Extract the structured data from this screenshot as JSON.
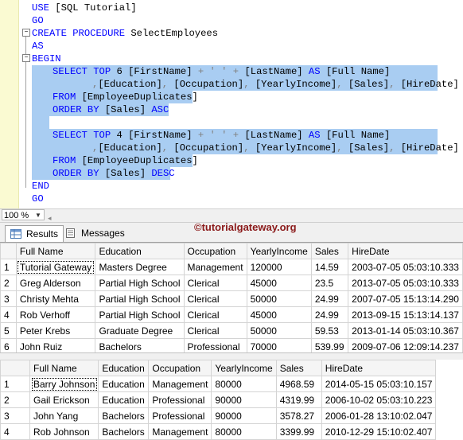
{
  "editor": {
    "lines": [
      {
        "parts": [
          {
            "t": "USE",
            "c": "kw"
          },
          {
            "t": " [SQL Tutorial]",
            "c": "id"
          }
        ]
      },
      {
        "parts": [
          {
            "t": "GO",
            "c": "kw"
          }
        ]
      },
      {
        "parts": [
          {
            "t": "CREATE PROCEDURE",
            "c": "kw"
          },
          {
            "t": " SelectEmployees",
            "c": "id"
          }
        ]
      },
      {
        "parts": [
          {
            "t": "AS",
            "c": "kw"
          }
        ]
      },
      {
        "parts": [
          {
            "t": "BEGIN",
            "c": "kw"
          }
        ]
      },
      {
        "parts": [
          {
            "t": "SELECT TOP",
            "c": "kw"
          },
          {
            "t": " 6 [FirstName] ",
            "c": "id"
          },
          {
            "t": "+",
            "c": "op"
          },
          {
            "t": " ",
            "c": "id"
          },
          {
            "t": "' '",
            "c": "op"
          },
          {
            "t": " ",
            "c": "id"
          },
          {
            "t": "+",
            "c": "op"
          },
          {
            "t": " [LastName] ",
            "c": "id"
          },
          {
            "t": "AS",
            "c": "kw"
          },
          {
            "t": " [Full Name]",
            "c": "id"
          }
        ]
      },
      {
        "parts": [
          {
            "t": ",",
            "c": "op"
          },
          {
            "t": "[Education]",
            "c": "id"
          },
          {
            "t": ",",
            "c": "op"
          },
          {
            "t": " [Occupation]",
            "c": "id"
          },
          {
            "t": ",",
            "c": "op"
          },
          {
            "t": " [YearlyIncome]",
            "c": "id"
          },
          {
            "t": ",",
            "c": "op"
          },
          {
            "t": " [Sales]",
            "c": "id"
          },
          {
            "t": ",",
            "c": "op"
          },
          {
            "t": " [HireDate]",
            "c": "id"
          }
        ]
      },
      {
        "parts": [
          {
            "t": "FROM",
            "c": "kw"
          },
          {
            "t": " [EmployeeDuplicates]",
            "c": "id"
          }
        ]
      },
      {
        "parts": [
          {
            "t": "ORDER BY",
            "c": "kw"
          },
          {
            "t": " [Sales] ",
            "c": "id"
          },
          {
            "t": "ASC",
            "c": "kw"
          }
        ]
      },
      {
        "parts": []
      },
      {
        "parts": [
          {
            "t": "SELECT TOP",
            "c": "kw"
          },
          {
            "t": " 4 [FirstName] ",
            "c": "id"
          },
          {
            "t": "+",
            "c": "op"
          },
          {
            "t": " ",
            "c": "id"
          },
          {
            "t": "' '",
            "c": "op"
          },
          {
            "t": " ",
            "c": "id"
          },
          {
            "t": "+",
            "c": "op"
          },
          {
            "t": " [LastName] ",
            "c": "id"
          },
          {
            "t": "AS",
            "c": "kw"
          },
          {
            "t": " [Full Name]",
            "c": "id"
          }
        ]
      },
      {
        "parts": [
          {
            "t": ",",
            "c": "op"
          },
          {
            "t": "[Education]",
            "c": "id"
          },
          {
            "t": ",",
            "c": "op"
          },
          {
            "t": " [Occupation]",
            "c": "id"
          },
          {
            "t": ",",
            "c": "op"
          },
          {
            "t": " [YearlyIncome]",
            "c": "id"
          },
          {
            "t": ",",
            "c": "op"
          },
          {
            "t": " [Sales]",
            "c": "id"
          },
          {
            "t": ",",
            "c": "op"
          },
          {
            "t": " [HireDate]",
            "c": "id"
          }
        ]
      },
      {
        "parts": [
          {
            "t": "FROM",
            "c": "kw"
          },
          {
            "t": " [EmployeeDuplicates]",
            "c": "id"
          }
        ]
      },
      {
        "parts": [
          {
            "t": "ORDER BY",
            "c": "kw"
          },
          {
            "t": " [Sales] ",
            "c": "id"
          },
          {
            "t": "DESC",
            "c": "kw"
          }
        ]
      },
      {
        "parts": [
          {
            "t": "END",
            "c": "kw"
          }
        ]
      },
      {
        "parts": [
          {
            "t": "GO",
            "c": "kw"
          }
        ]
      }
    ]
  },
  "zoom": {
    "value": "100 %"
  },
  "watermark": {
    "text": "©tutorialgateway.org"
  },
  "tabs": {
    "results": "Results",
    "messages": "Messages"
  },
  "grid1": {
    "headers": [
      "Full Name",
      "Education",
      "Occupation",
      "YearlyIncome",
      "Sales",
      "HireDate"
    ],
    "rows": [
      [
        "1",
        "Tutorial Gateway",
        "Masters Degree",
        "Management",
        "120000",
        "14.59",
        "2003-07-05 05:03:10.333"
      ],
      [
        "2",
        "Greg Alderson",
        "Partial High School",
        "Clerical",
        "45000",
        "23.5",
        "2013-07-05 05:03:10.333"
      ],
      [
        "3",
        "Christy Mehta",
        "Partial High School",
        "Clerical",
        "50000",
        "24.99",
        "2007-07-05 15:13:14.290"
      ],
      [
        "4",
        "Rob Verhoff",
        "Partial High School",
        "Clerical",
        "45000",
        "24.99",
        "2013-09-15 15:13:14.137"
      ],
      [
        "5",
        "Peter Krebs",
        "Graduate Degree",
        "Clerical",
        "50000",
        "59.53",
        "2013-01-14 05:03:10.367"
      ],
      [
        "6",
        "John Ruiz",
        "Bachelors",
        "Professional",
        "70000",
        "539.99",
        "2009-07-06 12:09:14.237"
      ]
    ]
  },
  "grid2": {
    "headers": [
      "Full Name",
      "Education",
      "Occupation",
      "YearlyIncome",
      "Sales",
      "HireDate"
    ],
    "rows": [
      [
        "1",
        "Barry Johnson",
        "Education",
        "Management",
        "80000",
        "4968.59",
        "2014-05-15 05:03:10.157"
      ],
      [
        "2",
        "Gail Erickson",
        "Education",
        "Professional",
        "90000",
        "4319.99",
        "2006-10-02 05:03:10.223"
      ],
      [
        "3",
        "John Yang",
        "Bachelors",
        "Professional",
        "90000",
        "3578.27",
        "2006-01-28 13:10:02.047"
      ],
      [
        "4",
        "Rob Johnson",
        "Bachelors",
        "Management",
        "80000",
        "3399.99",
        "2010-12-29 15:10:02.407"
      ]
    ]
  }
}
